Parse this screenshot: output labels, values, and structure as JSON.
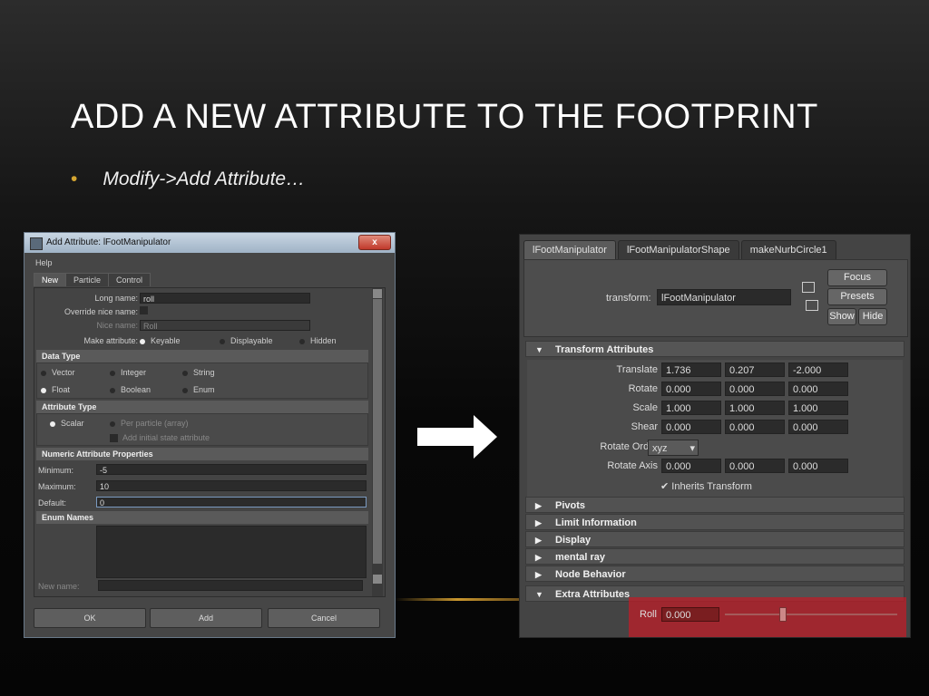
{
  "slide": {
    "title": "ADD A NEW ATTRIBUTE TO THE FOOTPRINT",
    "bullet_mark": "•",
    "bullet": "Modify->Add Attribute…"
  },
  "dialog": {
    "title": "Add Attribute: lFootManipulator",
    "close_label": "x",
    "menu": "Help",
    "tabs": [
      "New",
      "Particle",
      "Control"
    ],
    "long_name_label": "Long name:",
    "long_name_value": "roll",
    "override_label": "Override nice name:",
    "nice_name_label": "Nice name:",
    "nice_name_value": "Roll",
    "make_attr_label": "Make attribute:",
    "make_attr_options": [
      "Keyable",
      "Displayable",
      "Hidden"
    ],
    "data_type": {
      "heading": "Data Type",
      "options": [
        "Vector",
        "Integer",
        "String",
        "Float",
        "Boolean",
        "Enum"
      ],
      "selected": "Float"
    },
    "attribute_type": {
      "heading": "Attribute Type",
      "scalar": "Scalar",
      "per_particle": "Per particle (array)",
      "initial_state": "Add initial state attribute"
    },
    "numeric": {
      "heading": "Numeric Attribute Properties",
      "minimum_label": "Minimum:",
      "minimum": "-5",
      "maximum_label": "Maximum:",
      "maximum": "10",
      "default_label": "Default:",
      "default": "0"
    },
    "enum": {
      "heading": "Enum Names",
      "new_name_label": "New name:"
    },
    "buttons": {
      "ok": "OK",
      "add": "Add",
      "cancel": "Cancel"
    }
  },
  "editor": {
    "tabs": [
      "lFootManipulator",
      "lFootManipulatorShape",
      "makeNurbCircle1"
    ],
    "transform_label": "transform:",
    "transform_value": "lFootManipulator",
    "focus": "Focus",
    "presets": "Presets",
    "show": "Show",
    "hide": "Hide",
    "transform_attributes": "Transform Attributes",
    "rows": [
      {
        "label": "Translate",
        "values": [
          "1.736",
          "0.207",
          "-2.000"
        ]
      },
      {
        "label": "Rotate",
        "values": [
          "0.000",
          "0.000",
          "0.000"
        ]
      },
      {
        "label": "Scale",
        "values": [
          "1.000",
          "1.000",
          "1.000"
        ]
      },
      {
        "label": "Shear",
        "values": [
          "0.000",
          "0.000",
          "0.000"
        ]
      }
    ],
    "rotate_order_label": "Rotate Order",
    "rotate_order_value": "xyz",
    "rotate_axis_label": "Rotate Axis",
    "rotate_axis_values": [
      "0.000",
      "0.000",
      "0.000"
    ],
    "inherits_transform": "Inherits Transform",
    "sections": [
      "Pivots",
      "Limit Information",
      "Display",
      "mental ray",
      "Node Behavior"
    ],
    "extra_attributes": "Extra Attributes",
    "roll_label": "Roll",
    "roll_value": "0.000"
  },
  "colors": {
    "accent": "#d4a531",
    "highlight": "#be1e28"
  }
}
